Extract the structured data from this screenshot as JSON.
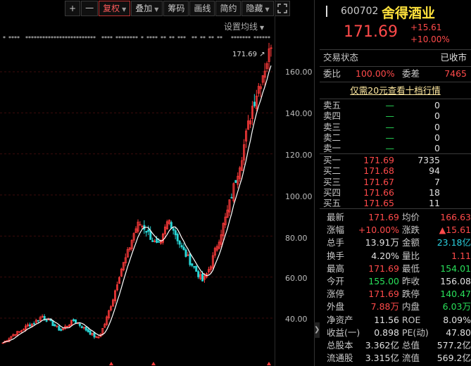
{
  "toolbar": {
    "plus": "+",
    "minus": "一",
    "fuquan": "复权",
    "diejia": "叠加",
    "choumai": "筹码",
    "huaxian": "画线",
    "jianyue": "简约",
    "yincang": "隐藏",
    "expand_icon": "expand-icon"
  },
  "chart": {
    "ma_setting": "设置均线",
    "high_label": "171.69",
    "y_ticks": [
      "160.00",
      "140.00",
      "120.00",
      "100.00",
      "80.00",
      "60.00",
      "40.00"
    ],
    "colors": {
      "up": "#ff3b3b",
      "down": "#29d6d6",
      "ma": "#ffffff",
      "grid": "#3b0b0b"
    }
  },
  "chart_data": {
    "type": "candlestick",
    "title": "",
    "ylim": [
      25,
      175
    ],
    "high": 171.69,
    "close_path": [
      28,
      29,
      30,
      31,
      32,
      33,
      33,
      34,
      35,
      36,
      37,
      37,
      38,
      39,
      40,
      41,
      40,
      39,
      38,
      37,
      36,
      35,
      34,
      35,
      36,
      37,
      38,
      39,
      38,
      37,
      36,
      35,
      34,
      33,
      32,
      31,
      30,
      32,
      35,
      38,
      42,
      46,
      50,
      55,
      60,
      64,
      67,
      70,
      74,
      78,
      82,
      85,
      86,
      85,
      84,
      82,
      80,
      78,
      76,
      75,
      76,
      80,
      85,
      88,
      86,
      83,
      80,
      77,
      74,
      72,
      70,
      68,
      66,
      64,
      62,
      60,
      58,
      60,
      63,
      66,
      70,
      74,
      78,
      82,
      86,
      90,
      95,
      100,
      105,
      110,
      115,
      120,
      126,
      132,
      138,
      144,
      148,
      152,
      156,
      160,
      164,
      168,
      171.69
    ]
  },
  "panel": {
    "code": "600702",
    "name": "舍得酒业",
    "price": "171.69",
    "change": "+15.61",
    "change_pct": "+10.00%",
    "status_label": "交易状态",
    "status_value": "已收市",
    "weibi_label": "委比",
    "weibi_value": "100.00%",
    "weicha_label": "委差",
    "weicha_value": "7465",
    "full_depth": "仅需20元查看十档行情",
    "sell": [
      {
        "label": "卖五",
        "price": "—",
        "vol": "0"
      },
      {
        "label": "卖四",
        "price": "—",
        "vol": "0"
      },
      {
        "label": "卖三",
        "price": "—",
        "vol": "0"
      },
      {
        "label": "卖二",
        "price": "—",
        "vol": "0"
      },
      {
        "label": "卖一",
        "price": "—",
        "vol": "0"
      }
    ],
    "buy": [
      {
        "label": "买一",
        "price": "171.69",
        "vol": "7335"
      },
      {
        "label": "买二",
        "price": "171.68",
        "vol": "94"
      },
      {
        "label": "买三",
        "price": "171.67",
        "vol": "7"
      },
      {
        "label": "买四",
        "price": "171.66",
        "vol": "18"
      },
      {
        "label": "买五",
        "price": "171.65",
        "vol": "11"
      }
    ],
    "quotes": [
      {
        "l1": "最新",
        "v1": "171.69",
        "c1": "red",
        "l2": "均价",
        "v2": "166.63",
        "c2": "red"
      },
      {
        "l1": "涨幅",
        "v1": "+10.00%",
        "c1": "red",
        "l2": "涨跌",
        "v2": "▲15.61",
        "c2": "red"
      },
      {
        "l1": "总手",
        "v1": "13.91万",
        "c1": "white",
        "l2": "金额",
        "v2": "23.18亿",
        "c2": "cyan"
      },
      {
        "l1": "换手",
        "v1": "4.20%",
        "c1": "white",
        "l2": "量比",
        "v2": "1.11",
        "c2": "red"
      },
      {
        "l1": "最高",
        "v1": "171.69",
        "c1": "red",
        "l2": "最低",
        "v2": "154.01",
        "c2": "green"
      },
      {
        "l1": "今开",
        "v1": "155.00",
        "c1": "green",
        "l2": "昨收",
        "v2": "156.08",
        "c2": "white"
      },
      {
        "l1": "涨停",
        "v1": "171.69",
        "c1": "red",
        "l2": "跌停",
        "v2": "140.47",
        "c2": "green"
      },
      {
        "l1": "外盘",
        "v1": "7.88万",
        "c1": "red",
        "l2": "内盘",
        "v2": "6.03万",
        "c2": "green"
      },
      {
        "l1": "净资产",
        "v1": "11.56",
        "c1": "white",
        "l2": "ROE",
        "v2": "8.09%",
        "c2": "white"
      },
      {
        "l1": "收益(一)",
        "v1": "0.898",
        "c1": "white",
        "l2": "PE(动)",
        "v2": "47.80",
        "c2": "white"
      },
      {
        "l1": "总股本",
        "v1": "3.362亿",
        "c1": "white",
        "l2": "总值",
        "v2": "577.2亿",
        "c2": "white"
      },
      {
        "l1": "流通股",
        "v1": "3.315亿",
        "c1": "white",
        "l2": "流值",
        "v2": "569.2亿",
        "c2": "white"
      }
    ]
  }
}
